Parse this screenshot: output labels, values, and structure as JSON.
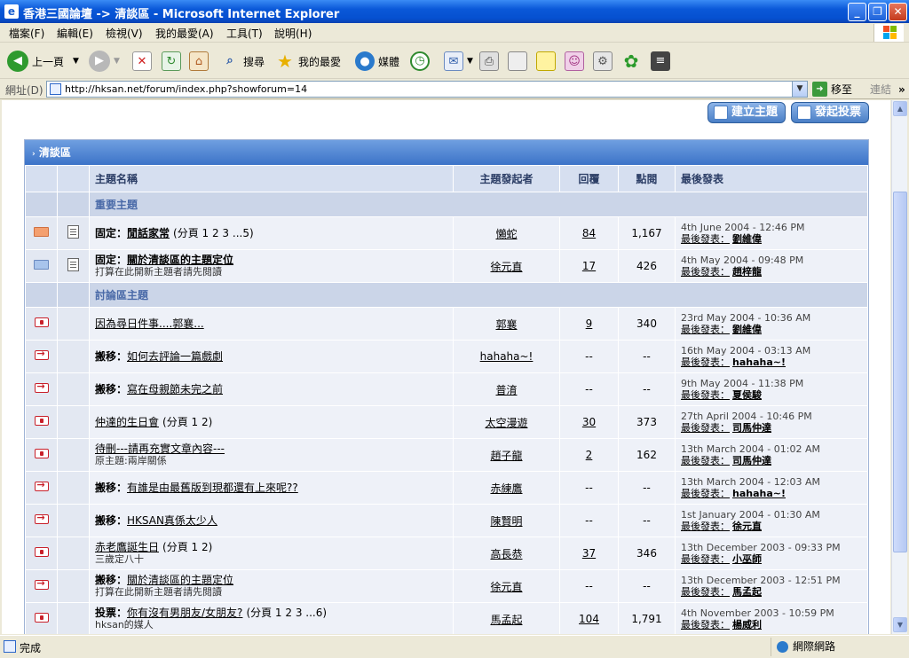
{
  "window": {
    "title": "香港三國論壇 -> 清談區 - Microsoft Internet Explorer",
    "btn_min": "_",
    "btn_max": "❐",
    "btn_close": "✕"
  },
  "menu": [
    "檔案(F)",
    "編輯(E)",
    "檢視(V)",
    "我的最愛(A)",
    "工具(T)",
    "說明(H)"
  ],
  "toolbar": {
    "back": "上一頁",
    "search": "搜尋",
    "favorites": "我的最愛",
    "media": "媒體"
  },
  "address": {
    "label": "網址(D)",
    "url": "http://hksan.net/forum/index.php?showforum=14",
    "go": "移至",
    "links": "連結",
    "more": "»"
  },
  "actions": {
    "new_topic": "建立主題",
    "new_poll": "發起投票"
  },
  "forum": {
    "title": "清談區",
    "columns": {
      "name": "主題名稱",
      "starter": "主題發起者",
      "replies": "回覆",
      "views": "點閱",
      "last": "最後發表"
    },
    "sections": {
      "pinned": "重要主題",
      "topics": "討論區主題"
    },
    "last_label": "最後發表：",
    "pinned_rows": [
      {
        "prefix": "固定：",
        "title": "閒話家常",
        "pages": "(分頁 1 2 3 ...5)",
        "sub": "",
        "starter": "懶蛇",
        "replies": "84",
        "views": "1,167",
        "last_date": "4th June 2004 - 12:46 PM",
        "last_by": "劉維偉",
        "icon": "mail-hot"
      },
      {
        "prefix": "固定：",
        "title": "關於清談區的主題定位",
        "pages": "",
        "sub": "打算在此開新主題者請先閱讀",
        "starter": "徐元直",
        "replies": "17",
        "views": "426",
        "last_date": "4th May 2004 - 09:48 PM",
        "last_by": "趙梓龍",
        "icon": "mail"
      }
    ],
    "rows": [
      {
        "prefix": "",
        "title": "因為尋日件事....郭襄...",
        "pages": "",
        "sub": "",
        "starter": "郭襄",
        "replies": "9",
        "views": "340",
        "last_date": "23rd May 2004 - 10:36 AM",
        "last_by": "劉維偉",
        "icon": "red"
      },
      {
        "prefix": "搬移：",
        "title": "如何去評論一篇戲劇",
        "pages": "",
        "sub": "",
        "starter": "hahaha~!",
        "replies": "--",
        "views": "--",
        "last_date": "16th May 2004 - 03:13 AM",
        "last_by": "hahaha~!",
        "icon": "move"
      },
      {
        "prefix": "搬移：",
        "title": "寫在母親節未完之前",
        "pages": "",
        "sub": "",
        "starter": "普淯",
        "replies": "--",
        "views": "--",
        "last_date": "9th May 2004 - 11:38 PM",
        "last_by": "夏侯駿",
        "icon": "move"
      },
      {
        "prefix": "",
        "title": "仲達的生日會",
        "pages": "(分頁 1 2)",
        "sub": "",
        "starter": "太空漫遊",
        "replies": "30",
        "views": "373",
        "last_date": "27th April 2004 - 10:46 PM",
        "last_by": "司馬仲達",
        "icon": "red"
      },
      {
        "prefix": "",
        "title": "待刪---請再充實文章內容---",
        "pages": "",
        "sub": "原主題:兩岸關係",
        "starter": "趙子龍",
        "replies": "2",
        "views": "162",
        "last_date": "13th March 2004 - 01:02 AM",
        "last_by": "司馬仲達",
        "icon": "red"
      },
      {
        "prefix": "搬移：",
        "title": "有誰是由最舊版到現都還有上來呢??",
        "pages": "",
        "sub": "",
        "starter": "赤練鷹",
        "replies": "--",
        "views": "--",
        "last_date": "13th March 2004 - 12:03 AM",
        "last_by": "hahaha~!",
        "icon": "move"
      },
      {
        "prefix": "搬移：",
        "title": "HKSAN真係太少人",
        "pages": "",
        "sub": "",
        "starter": "陳賢明",
        "replies": "--",
        "views": "--",
        "last_date": "1st January 2004 - 01:30 AM",
        "last_by": "徐元直",
        "icon": "move"
      },
      {
        "prefix": "",
        "title": "赤老鷹誕生日",
        "pages": "(分頁 1 2)",
        "sub": "三歲定八十",
        "starter": "高長恭",
        "replies": "37",
        "views": "346",
        "last_date": "13th December 2003 - 09:33 PM",
        "last_by": "小巫師",
        "icon": "red"
      },
      {
        "prefix": "搬移：",
        "title": "關於清談區的主題定位",
        "pages": "",
        "sub": "打算在此開新主題者請先閱讀",
        "starter": "徐元直",
        "replies": "--",
        "views": "--",
        "last_date": "13th December 2003 - 12:51 PM",
        "last_by": "馬孟起",
        "icon": "move"
      },
      {
        "prefix": "投票：",
        "title": "你有沒有男朋友/女朋友?",
        "pages": "(分頁 1 2 3 ...6)",
        "sub": "hksan的媒人",
        "starter": "馬孟起",
        "replies": "104",
        "views": "1,791",
        "last_date": "4th November 2003 - 10:59 PM",
        "last_by": "楊威利",
        "icon": "red"
      }
    ]
  },
  "status": {
    "text": "完成",
    "zone": "網際網路"
  },
  "colors": {
    "header_blue": "#3c73c8",
    "section_bg": "#cbd5e8",
    "row_bg": "#eef1f8",
    "title_blue": "#0a58d8"
  }
}
